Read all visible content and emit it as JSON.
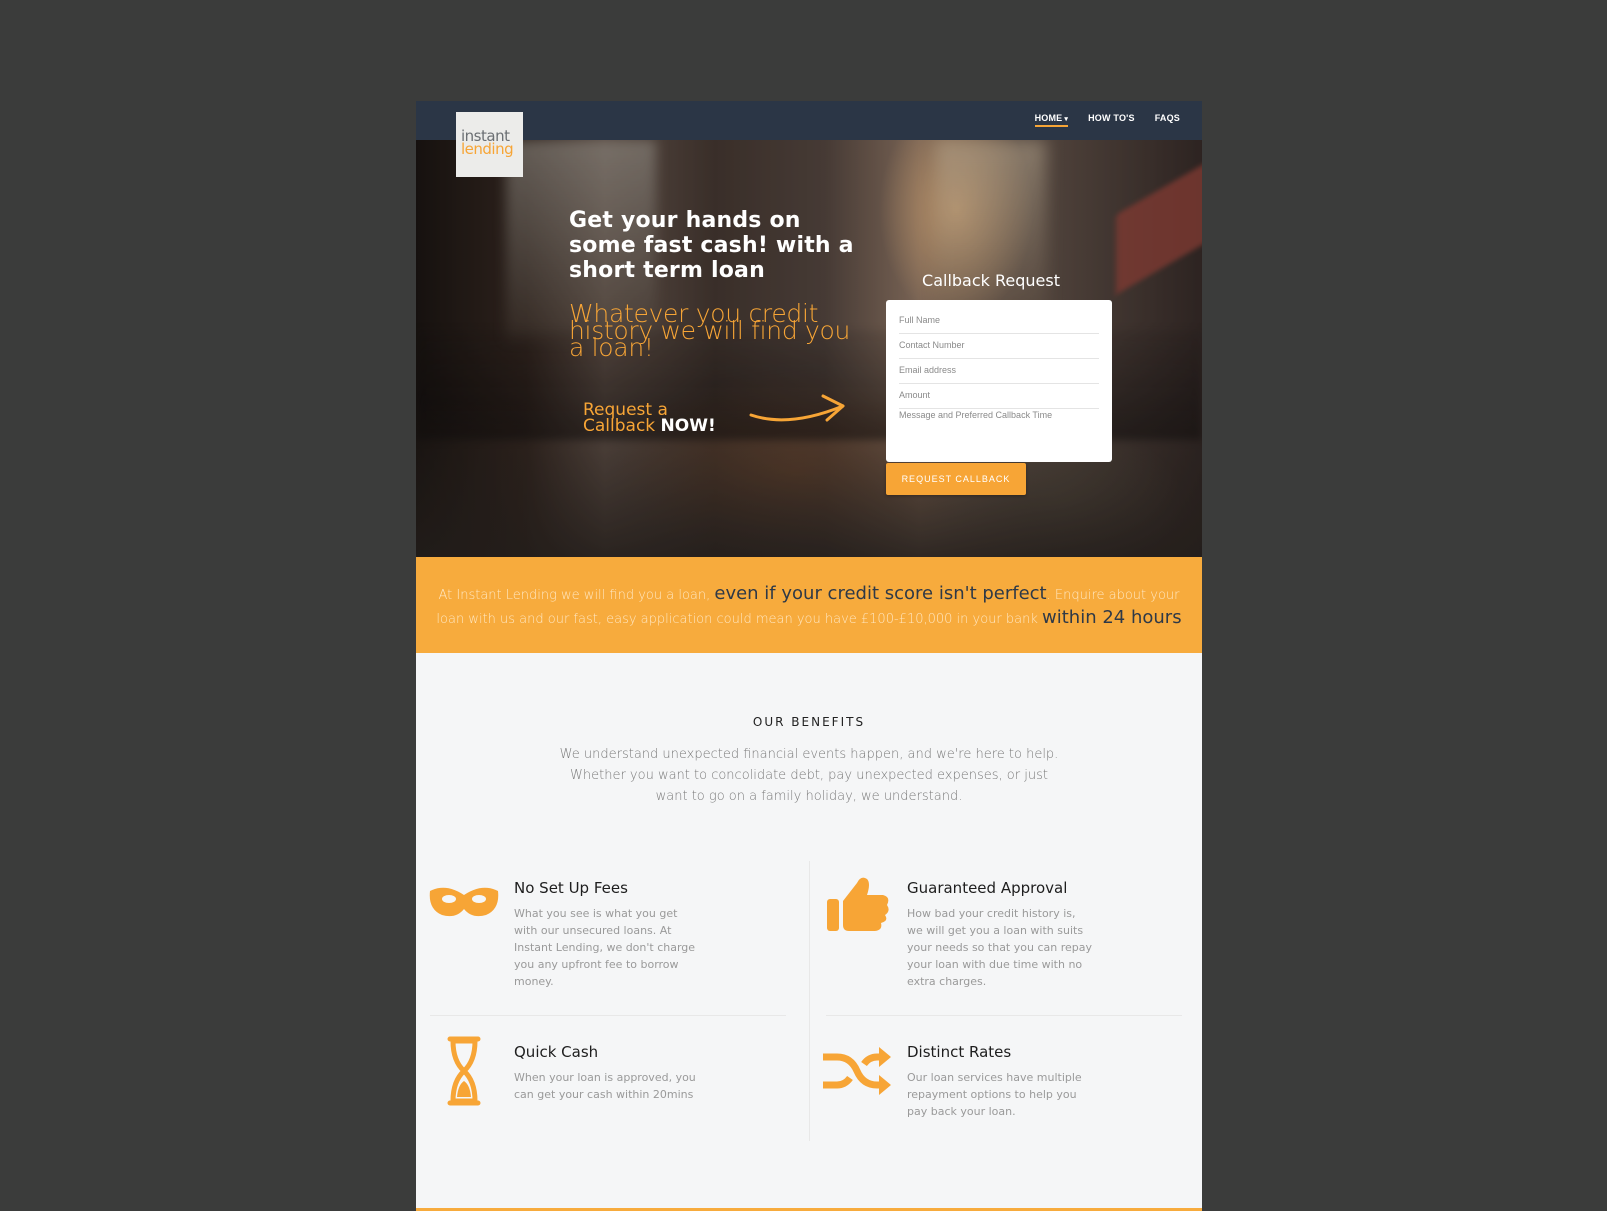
{
  "brand": {
    "logo_line1": "instant",
    "logo_line2": "lending"
  },
  "nav": {
    "items": [
      "HOME",
      "HOW TO'S",
      "FAQS"
    ],
    "caret": "▾"
  },
  "hero": {
    "title": "Get your hands on some fast cash! with a short term loan",
    "subtitle": "Whatever you credit history we will find you a loan!",
    "cta_prefix": "Request a Callback",
    "cta_strong": "NOW!"
  },
  "callback_form": {
    "title": "Callback Request",
    "placeholders": {
      "full_name": "Full Name",
      "contact_number": "Contact Number",
      "email": "Email address",
      "amount": "Amount",
      "message": "Message and Preferred Callback Time"
    },
    "submit_label": "REQUEST CALLBACK"
  },
  "band": {
    "part1": "At Instant Lending we will find you a loan, ",
    "highlight1": "even if your credit score isn't perfect",
    "part2": ". Enquire about your loan with us and our fast, easy application could mean you have £100-£10,000 in your bank ",
    "highlight2": "within 24 hours"
  },
  "benefits": {
    "title": "OUR BENEFITS",
    "intro": "We understand unexpected financial events happen, and we're here to help. Whether you want to concolidate debt, pay unexpected expenses, or just want to go on a family holiday, we understand.",
    "items": [
      {
        "icon": "mask-icon",
        "title": "No Set Up Fees",
        "text": "What you see is what you get with our unsecured loans. At Instant Lending, we don't charge you any upfront fee to borrow money."
      },
      {
        "icon": "thumbs-up-icon",
        "title": "Guaranteed Approval",
        "text": "How bad your credit history is, we will get you a loan with suits your needs so that you can repay your loan with due time with no extra charges."
      },
      {
        "icon": "hourglass-icon",
        "title": "Quick Cash",
        "text": "When your loan is approved, you can get your cash within 20mins"
      },
      {
        "icon": "shuffle-icon",
        "title": "Distinct Rates",
        "text": "Our loan services have multiple repayment options to help you pay back your loan."
      }
    ]
  },
  "colors": {
    "accent": "#f7a536",
    "nav_bg": "#2b3646",
    "page_bg": "#3b3c3b"
  }
}
